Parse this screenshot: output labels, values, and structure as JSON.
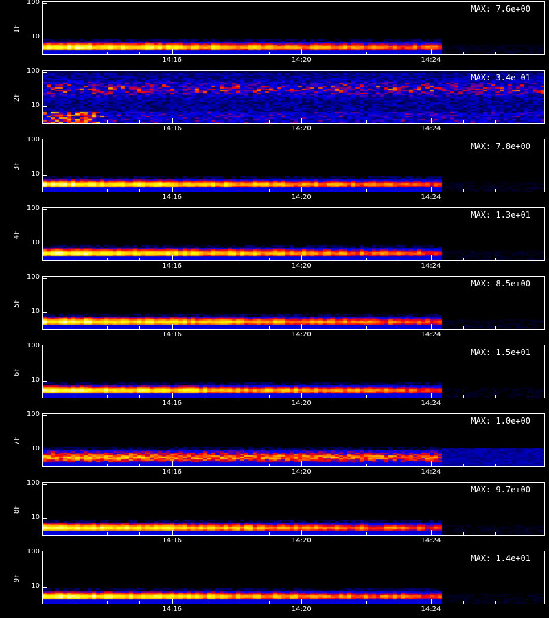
{
  "chart_data": {
    "type": "heatmap",
    "panels": [
      {
        "label": "1F",
        "max": "MAX: 7.6e+00",
        "pattern": "band"
      },
      {
        "label": "2F",
        "max": "MAX: 3.4e-01",
        "pattern": "noise"
      },
      {
        "label": "3F",
        "max": "MAX: 7.8e+00",
        "pattern": "band"
      },
      {
        "label": "4F",
        "max": "MAX: 1.3e+01",
        "pattern": "band"
      },
      {
        "label": "5F",
        "max": "MAX: 8.5e+00",
        "pattern": "band"
      },
      {
        "label": "6F",
        "max": "MAX: 1.5e+01",
        "pattern": "band"
      },
      {
        "label": "7F",
        "max": "MAX: 1.0e+00",
        "pattern": "wide"
      },
      {
        "label": "8F",
        "max": "MAX: 9.7e+00",
        "pattern": "band"
      },
      {
        "label": "9F",
        "max": "MAX: 1.4e+01",
        "pattern": "band"
      }
    ],
    "y_ticks": [
      "100",
      "10"
    ],
    "x_ticks": [
      "14:16",
      "14:20",
      "14:24"
    ],
    "x_tick_minutes": [
      16,
      20,
      24
    ],
    "x_range_minutes": [
      12.0,
      27.5
    ],
    "data_end_minutes": 24.3,
    "y_scale": "log",
    "colormap": [
      "#000000",
      "#00007f",
      "#0000ff",
      "#ff0000",
      "#ffa500",
      "#ffff00",
      "#ffffff"
    ]
  }
}
